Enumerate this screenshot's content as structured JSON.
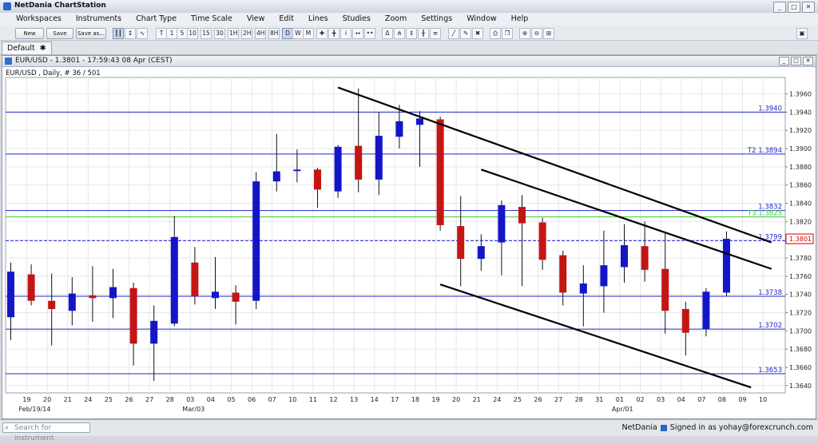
{
  "app": {
    "title": "NetDania ChartStation",
    "window_buttons": [
      "_",
      "□",
      "✕"
    ]
  },
  "menu": [
    "Workspaces",
    "Instruments",
    "Chart Type",
    "Time Scale",
    "View",
    "Edit",
    "Lines",
    "Studies",
    "Zoom",
    "Settings",
    "Window",
    "Help"
  ],
  "toolbar": {
    "new_label": "New",
    "save_label": "Save",
    "saveas_label": "Save as...",
    "timescales": [
      "T",
      "1",
      "5",
      "10",
      "15",
      "30",
      "1H",
      "2H",
      "4H",
      "8H",
      "D",
      "W",
      "M"
    ],
    "active_timescale": "D"
  },
  "workspace_tab": {
    "label": "Default",
    "close": "✱"
  },
  "chart_window": {
    "title": "EUR/USD - 1.3801 - 17:59:43  08 Apr (CEST)",
    "info": "EUR/USD , Daily, # 36 / 501"
  },
  "statusbar": {
    "search_placeholder": "Search for instrument",
    "brand": "NetDania",
    "signed_in": "Signed in as yohay@forexcrunch.com"
  },
  "colors": {
    "up": "#1515c8",
    "down": "#c41414",
    "hline": "#2525d0",
    "t3line": "#33cc33",
    "price_badge": "#cc0000"
  },
  "chart_data": {
    "type": "candlestick",
    "symbol": "EUR/USD",
    "ylim": [
      1.3632,
      1.3978
    ],
    "yticks": [
      "1.3640",
      "1.3660",
      "1.3680",
      "1.3700",
      "1.3720",
      "1.3740",
      "1.3760",
      "1.3780",
      "1.3800",
      "1.3820",
      "1.3840",
      "1.3860",
      "1.3880",
      "1.3900",
      "1.3920",
      "1.3940",
      "1.3960"
    ],
    "x_labels": [
      "19",
      "20",
      "21",
      "24",
      "25",
      "26",
      "27",
      "28",
      "03",
      "04",
      "05",
      "06",
      "07",
      "10",
      "11",
      "12",
      "13",
      "14",
      "17",
      "18",
      "19",
      "20",
      "21",
      "24",
      "25",
      "26",
      "27",
      "28",
      "31",
      "01",
      "02",
      "03",
      "04",
      "07",
      "08",
      "09",
      "10"
    ],
    "date_labels": [
      {
        "text": "Feb/19/14",
        "at": 0
      },
      {
        "text": "Mar/03",
        "at": 8
      },
      {
        "text": "Apr/01",
        "at": 29
      }
    ],
    "candles": [
      {
        "date": "Feb-18",
        "o": 1.3715,
        "h": 1.3775,
        "l": 1.369,
        "c": 1.3765
      },
      {
        "date": "Feb-19",
        "o": 1.3762,
        "h": 1.3773,
        "l": 1.3728,
        "c": 1.3733
      },
      {
        "date": "Feb-20",
        "o": 1.3733,
        "h": 1.3763,
        "l": 1.3684,
        "c": 1.3724
      },
      {
        "date": "Feb-21",
        "o": 1.3722,
        "h": 1.3759,
        "l": 1.3706,
        "c": 1.3741
      },
      {
        "date": "Feb-24",
        "o": 1.3739,
        "h": 1.3771,
        "l": 1.371,
        "c": 1.3736
      },
      {
        "date": "Feb-25",
        "o": 1.3736,
        "h": 1.3768,
        "l": 1.3714,
        "c": 1.3748
      },
      {
        "date": "Feb-26",
        "o": 1.3747,
        "h": 1.3753,
        "l": 1.3662,
        "c": 1.3686
      },
      {
        "date": "Feb-27",
        "o": 1.3686,
        "h": 1.3728,
        "l": 1.3645,
        "c": 1.3711
      },
      {
        "date": "Feb-28",
        "o": 1.3708,
        "h": 1.3826,
        "l": 1.3705,
        "c": 1.3803
      },
      {
        "date": "Mar-03",
        "o": 1.3775,
        "h": 1.3792,
        "l": 1.3729,
        "c": 1.3738
      },
      {
        "date": "Mar-04",
        "o": 1.3736,
        "h": 1.3781,
        "l": 1.3724,
        "c": 1.3743
      },
      {
        "date": "Mar-05",
        "o": 1.3742,
        "h": 1.375,
        "l": 1.3707,
        "c": 1.3732
      },
      {
        "date": "Mar-06",
        "o": 1.3733,
        "h": 1.3874,
        "l": 1.3724,
        "c": 1.3864
      },
      {
        "date": "Mar-07",
        "o": 1.3864,
        "h": 1.3916,
        "l": 1.3853,
        "c": 1.3875
      },
      {
        "date": "Mar-10",
        "o": 1.3876,
        "h": 1.3899,
        "l": 1.3863,
        "c": 1.3877
      },
      {
        "date": "Mar-11",
        "o": 1.3877,
        "h": 1.3879,
        "l": 1.3835,
        "c": 1.3855
      },
      {
        "date": "Mar-12",
        "o": 1.3853,
        "h": 1.3904,
        "l": 1.3846,
        "c": 1.3902
      },
      {
        "date": "Mar-13",
        "o": 1.3903,
        "h": 1.3966,
        "l": 1.3852,
        "c": 1.3866
      },
      {
        "date": "Mar-14",
        "o": 1.3866,
        "h": 1.394,
        "l": 1.3849,
        "c": 1.3914
      },
      {
        "date": "Mar-17",
        "o": 1.3913,
        "h": 1.3948,
        "l": 1.39,
        "c": 1.393
      },
      {
        "date": "Mar-18",
        "o": 1.3926,
        "h": 1.3941,
        "l": 1.388,
        "c": 1.3933
      },
      {
        "date": "Mar-19",
        "o": 1.3932,
        "h": 1.3935,
        "l": 1.381,
        "c": 1.3816
      },
      {
        "date": "Mar-20",
        "o": 1.3815,
        "h": 1.3848,
        "l": 1.3749,
        "c": 1.3779
      },
      {
        "date": "Mar-21",
        "o": 1.3779,
        "h": 1.3806,
        "l": 1.3766,
        "c": 1.3793
      },
      {
        "date": "Mar-24",
        "o": 1.3797,
        "h": 1.3843,
        "l": 1.3761,
        "c": 1.3838
      },
      {
        "date": "Mar-25",
        "o": 1.3836,
        "h": 1.3849,
        "l": 1.3749,
        "c": 1.3818
      },
      {
        "date": "Mar-26",
        "o": 1.3819,
        "h": 1.3824,
        "l": 1.3767,
        "c": 1.3778
      },
      {
        "date": "Mar-27",
        "o": 1.3783,
        "h": 1.3788,
        "l": 1.3728,
        "c": 1.3742
      },
      {
        "date": "Mar-28",
        "o": 1.3741,
        "h": 1.3772,
        "l": 1.3705,
        "c": 1.3752
      },
      {
        "date": "Mar-31",
        "o": 1.3749,
        "h": 1.381,
        "l": 1.372,
        "c": 1.3772
      },
      {
        "date": "Apr-01",
        "o": 1.377,
        "h": 1.3817,
        "l": 1.3753,
        "c": 1.3794
      },
      {
        "date": "Apr-02",
        "o": 1.3793,
        "h": 1.382,
        "l": 1.3754,
        "c": 1.3767
      },
      {
        "date": "Apr-03",
        "o": 1.3768,
        "h": 1.3808,
        "l": 1.3697,
        "c": 1.3722
      },
      {
        "date": "Apr-04",
        "o": 1.3724,
        "h": 1.3732,
        "l": 1.3673,
        "c": 1.3698
      },
      {
        "date": "Apr-07",
        "o": 1.3702,
        "h": 1.3747,
        "l": 1.3694,
        "c": 1.3743
      },
      {
        "date": "Apr-08",
        "o": 1.3742,
        "h": 1.3809,
        "l": 1.3738,
        "c": 1.3801
      }
    ],
    "hlines": [
      {
        "label": "1.3940",
        "value": 1.394,
        "color": "#2525d0"
      },
      {
        "label": "T2 1.3894",
        "value": 1.3894,
        "color": "#2525d0"
      },
      {
        "label": "1.3832",
        "value": 1.3832,
        "color": "#2525d0"
      },
      {
        "label": "T3 1.3825",
        "value": 1.3825,
        "color": "#33cc33"
      },
      {
        "label": "1.3799",
        "value": 1.3799,
        "color": "#2525d0",
        "dashed": true
      },
      {
        "label": "1.3738",
        "value": 1.3738,
        "color": "#2525d0"
      },
      {
        "label": "1.3702",
        "value": 1.3702,
        "color": "#2525d0"
      },
      {
        "label": "1.3653",
        "value": 1.3653,
        "color": "#2525d0"
      }
    ],
    "trendlines": [
      {
        "x1": 16,
        "y1": 1.3967,
        "x2": 37.2,
        "y2": 1.3797
      },
      {
        "x1": 23,
        "y1": 1.3877,
        "x2": 37.2,
        "y2": 1.3768
      },
      {
        "x1": 21,
        "y1": 1.3751,
        "x2": 36.2,
        "y2": 1.3638
      }
    ],
    "last_price": "1.3801",
    "grid": true
  }
}
